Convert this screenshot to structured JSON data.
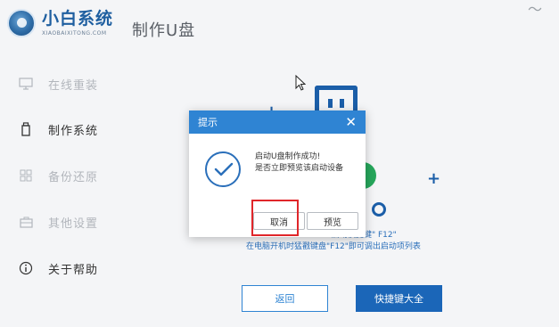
{
  "app": {
    "name": "小白系统",
    "subtitle": "XIAOBAIXITONG.COM",
    "page_title": "制作U盘",
    "close_glyph": "〜"
  },
  "sidebar": {
    "items": [
      {
        "label": "在线重装",
        "icon": "monitor-icon",
        "state": "inactive"
      },
      {
        "label": "制作系统",
        "icon": "usb-icon",
        "state": "active"
      },
      {
        "label": "备份还原",
        "icon": "grid-icon",
        "state": "inactive"
      },
      {
        "label": "其他设置",
        "icon": "briefcase-icon",
        "state": "inactive"
      },
      {
        "label": "关于帮助",
        "icon": "info-icon",
        "state": "normal"
      }
    ]
  },
  "main": {
    "hint_line1": "启动快捷键\" F12\"",
    "hint_line2": "在电脑开机时猛戳键盘\"F12\"即可调出启动项列表",
    "back_button": "返回",
    "hotkey_button": "快捷键大全"
  },
  "dialog": {
    "title": "提示",
    "message_line1": "启动U盘制作成功!",
    "message_line2": "是否立即预览该启动设备",
    "cancel_label": "取消",
    "preview_label": "预览",
    "close_glyph": "✕"
  },
  "colors": {
    "accent": "#2f84d3",
    "brand": "#1f5fa0",
    "primary_button": "#1b66b8",
    "highlight_box": "#e0262a"
  }
}
